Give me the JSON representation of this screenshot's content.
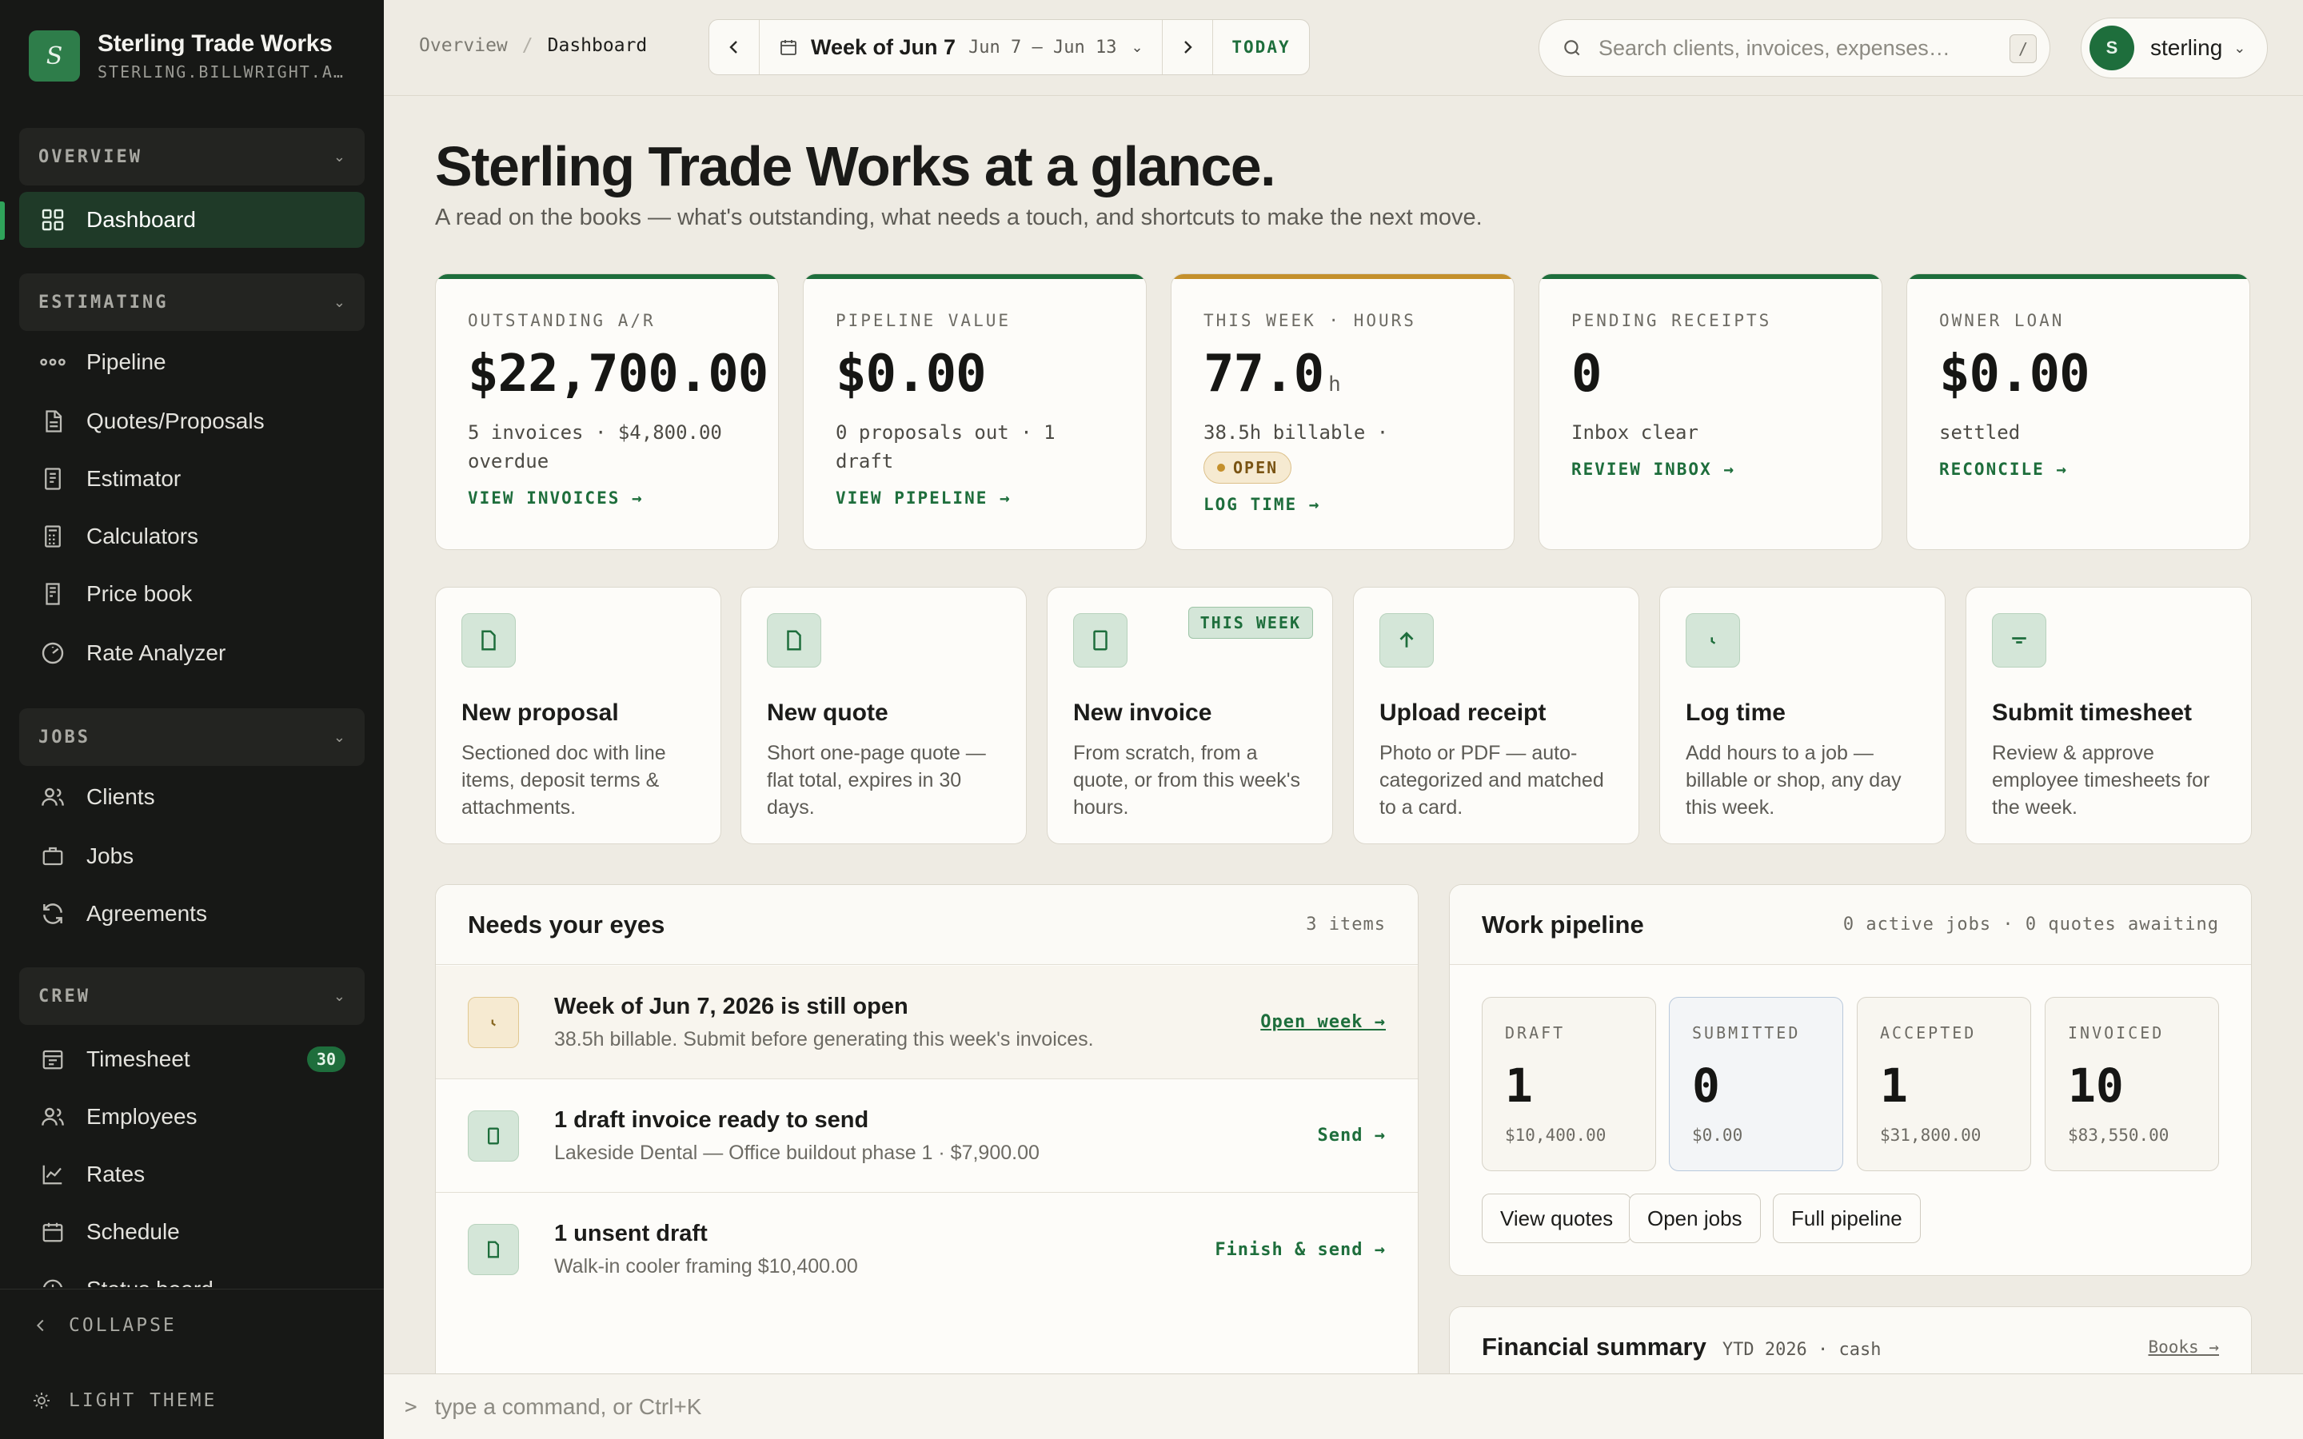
{
  "brand": {
    "name": "Sterling Trade Works",
    "subtitle": "STERLING.BILLWRIGHT.A…",
    "logo_letter": "S"
  },
  "sidebar": {
    "sections": [
      {
        "label": "OVERVIEW",
        "items": [
          {
            "label": "Dashboard",
            "icon": "grid-icon",
            "active": true
          }
        ]
      },
      {
        "label": "ESTIMATING",
        "items": [
          {
            "label": "Pipeline",
            "icon": "pipeline-icon"
          },
          {
            "label": "Quotes/Proposals",
            "icon": "document-icon"
          },
          {
            "label": "Estimator",
            "icon": "receipt-icon"
          },
          {
            "label": "Calculators",
            "icon": "calculator-icon"
          },
          {
            "label": "Price book",
            "icon": "book-icon"
          },
          {
            "label": "Rate Analyzer",
            "icon": "gauge-icon"
          }
        ]
      },
      {
        "label": "JOBS",
        "items": [
          {
            "label": "Clients",
            "icon": "users-icon"
          },
          {
            "label": "Jobs",
            "icon": "briefcase-icon"
          },
          {
            "label": "Agreements",
            "icon": "refresh-icon"
          }
        ]
      },
      {
        "label": "CREW",
        "items": [
          {
            "label": "Timesheet",
            "icon": "timesheet-icon",
            "badge": "30"
          },
          {
            "label": "Employees",
            "icon": "users-icon"
          },
          {
            "label": "Rates",
            "icon": "chart-line-icon"
          },
          {
            "label": "Schedule",
            "icon": "calendar-icon"
          },
          {
            "label": "Status board",
            "icon": "clock-icon"
          }
        ]
      }
    ],
    "collapse_label": "COLLAPSE",
    "theme_label": "LIGHT THEME"
  },
  "topbar": {
    "breadcrumb": [
      "Overview",
      "Dashboard"
    ],
    "week_title": "Week of Jun 7",
    "week_range": "Jun 7 – Jun 13",
    "today_label": "TODAY",
    "search_placeholder": "Search clients, invoices, expenses…",
    "search_shortcut": "/",
    "user_name": "sterling",
    "user_initial": "S"
  },
  "page": {
    "title": "Sterling Trade Works at a glance.",
    "subtitle": "A read on the books — what's outstanding, what needs a touch, and shortcuts to make the next move."
  },
  "kpis": [
    {
      "label": "OUTSTANDING A/R",
      "value": "$22,700.00",
      "note": "5 invoices · $4,800.00 overdue",
      "link": "VIEW INVOICES →",
      "accent": "#1e6e3c"
    },
    {
      "label": "PIPELINE VALUE",
      "value": "$0.00",
      "note": "0 proposals out · 1 draft",
      "link": "VIEW PIPELINE →",
      "accent": "#1e6e3c"
    },
    {
      "label": "THIS WEEK · HOURS",
      "value": "77.0",
      "unit": "h",
      "note": "38.5h billable ·",
      "pill": "OPEN",
      "link": "LOG TIME →",
      "accent": "#c4902c"
    },
    {
      "label": "PENDING RECEIPTS",
      "value": "0",
      "note": "Inbox clear",
      "link": "REVIEW INBOX →",
      "accent": "#1e6e3c"
    },
    {
      "label": "OWNER LOAN",
      "value": "$0.00",
      "note": "settled",
      "link": "RECONCILE →",
      "accent": "#1e6e3c"
    }
  ],
  "actions": [
    {
      "title": "New proposal",
      "desc": "Sectioned doc with line items, deposit terms & attachments.",
      "icon": "document-icon"
    },
    {
      "title": "New quote",
      "desc": "Short one-page quote — flat total, expires in 30 days.",
      "icon": "document-icon"
    },
    {
      "title": "New invoice",
      "desc": "From scratch, from a quote, or from this week's hours.",
      "icon": "invoice-icon",
      "tag": "THIS WEEK"
    },
    {
      "title": "Upload receipt",
      "desc": "Photo or PDF — auto-categorized and matched to a card.",
      "icon": "upload-icon"
    },
    {
      "title": "Log time",
      "desc": "Add hours to a job — billable or shop, any day this week.",
      "icon": "clock-icon"
    },
    {
      "title": "Submit timesheet",
      "desc": "Review & approve employee timesheets for the week.",
      "icon": "filter-icon"
    }
  ],
  "needs_eyes": {
    "title": "Needs your eyes",
    "count": "3 items",
    "items": [
      {
        "title": "Week of Jun 7, 2026 is still open",
        "sub": "38.5h billable. Submit before generating this week's invoices.",
        "action": "Open week →",
        "icon": "clock-icon"
      },
      {
        "title": "1 draft invoice ready to send",
        "sub": "Lakeside Dental — Office buildout phase 1 · $7,900.00",
        "action": "Send →",
        "icon": "invoice-icon"
      },
      {
        "title": "1 unsent draft",
        "sub": "Walk-in cooler framing $10,400.00",
        "action": "Finish & send →",
        "icon": "document-icon"
      }
    ]
  },
  "pipeline": {
    "title": "Work pipeline",
    "meta": "0 active jobs · 0 quotes awaiting",
    "stages": [
      {
        "label": "DRAFT",
        "count": "1",
        "amount": "$10,400.00"
      },
      {
        "label": "SUBMITTED",
        "count": "0",
        "amount": "$0.00"
      },
      {
        "label": "ACCEPTED",
        "count": "1",
        "amount": "$31,800.00"
      },
      {
        "label": "INVOICED",
        "count": "10",
        "amount": "$83,550.00"
      }
    ],
    "buttons": [
      "View quotes",
      "Open jobs",
      "Full pipeline"
    ]
  },
  "financial": {
    "title": "Financial summary",
    "meta": "YTD 2026 · cash",
    "link": "Books →"
  },
  "command_bar": {
    "prompt": ">",
    "placeholder": "type a command, or Ctrl+K"
  }
}
